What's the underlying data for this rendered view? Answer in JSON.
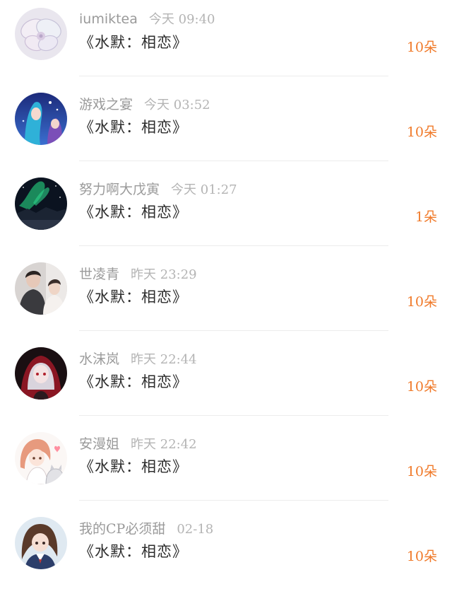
{
  "accent_color": "#f07a2a",
  "items": [
    {
      "username": "iumiktea",
      "time": "今天 09:40",
      "gift": "《水默：相恋》",
      "count": "10朵",
      "avatar_icon": "orchid-flower-avatar"
    },
    {
      "username": "游戏之宴",
      "time": "今天 03:52",
      "gift": "《水默：相恋》",
      "count": "10朵",
      "avatar_icon": "anime-night-sky-avatar"
    },
    {
      "username": "努力啊大戊寅",
      "time": "今天 01:27",
      "gift": "《水默：相恋》",
      "count": "1朵",
      "avatar_icon": "aurora-landscape-avatar"
    },
    {
      "username": "世凌青",
      "time": "昨天 23:29",
      "gift": "《水默：相恋》",
      "count": "10朵",
      "avatar_icon": "couple-photo-avatar"
    },
    {
      "username": "水沫岚",
      "time": "昨天 22:44",
      "gift": "《水默：相恋》",
      "count": "10朵",
      "avatar_icon": "anime-red-hood-avatar"
    },
    {
      "username": "安漫姐",
      "time": "昨天 22:42",
      "gift": "《水默：相恋》",
      "count": "10朵",
      "avatar_icon": "anime-girl-with-cat-avatar"
    },
    {
      "username": "我的CP必须甜",
      "time": "02-18",
      "gift": "《水默：相恋》",
      "count": "10朵",
      "avatar_icon": "anime-schoolgirl-avatar"
    }
  ]
}
